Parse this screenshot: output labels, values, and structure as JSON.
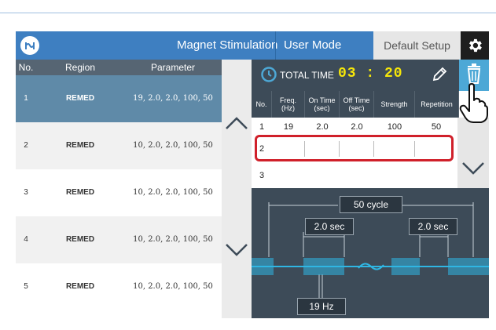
{
  "header": {
    "logo_text": "ᴴ¹¹",
    "app_title": "Magnet Stimulation",
    "mode": "User Mode",
    "default_setup": "Default Setup",
    "settings_icon": "gear-icon"
  },
  "left_table": {
    "columns": [
      "No.",
      "Region",
      "Parameter"
    ],
    "rows": [
      {
        "no": "1",
        "region": "REMED",
        "parameter": "19, 2.0, 2.0, 100, 50",
        "selected": true
      },
      {
        "no": "2",
        "region": "REMED",
        "parameter": "10, 2.0, 2.0, 100, 50"
      },
      {
        "no": "3",
        "region": "REMED",
        "parameter": "10, 2.0, 2.0, 100, 50"
      },
      {
        "no": "4",
        "region": "REMED",
        "parameter": "10, 2.0, 2.0, 100, 50"
      },
      {
        "no": "5",
        "region": "REMED",
        "parameter": "10, 2.0, 2.0, 100, 50"
      }
    ]
  },
  "total_time": {
    "label": "TOTAL TIME",
    "value": "03 : 20"
  },
  "param_table": {
    "columns": [
      "No.",
      "Freq.\n(Hz)",
      "On Time\n(sec)",
      "Off Time\n(sec)",
      "Strength",
      "Repetition"
    ],
    "rows": [
      {
        "no": "1",
        "freq": "19",
        "on": "2.0",
        "off": "2.0",
        "strength": "100",
        "repetition": "50"
      },
      {
        "no": "2",
        "freq": "",
        "on": "",
        "off": "",
        "strength": "",
        "repetition": ""
      },
      {
        "no": "3",
        "freq": "",
        "on": "",
        "off": "",
        "strength": "",
        "repetition": ""
      }
    ]
  },
  "diagram": {
    "cycle_label": "50 cycle",
    "on_time_label": "2.0 sec",
    "off_time_label": "2.0 sec",
    "freq_label": "19 Hz"
  },
  "colors": {
    "header_blue": "#3e7fc1",
    "selected_row": "#5f8aa8",
    "panel_dark": "#3d4b58",
    "time_yellow": "#f5e60a",
    "accent_cyan": "#4da8d6",
    "highlight_red": "#d0202a"
  }
}
